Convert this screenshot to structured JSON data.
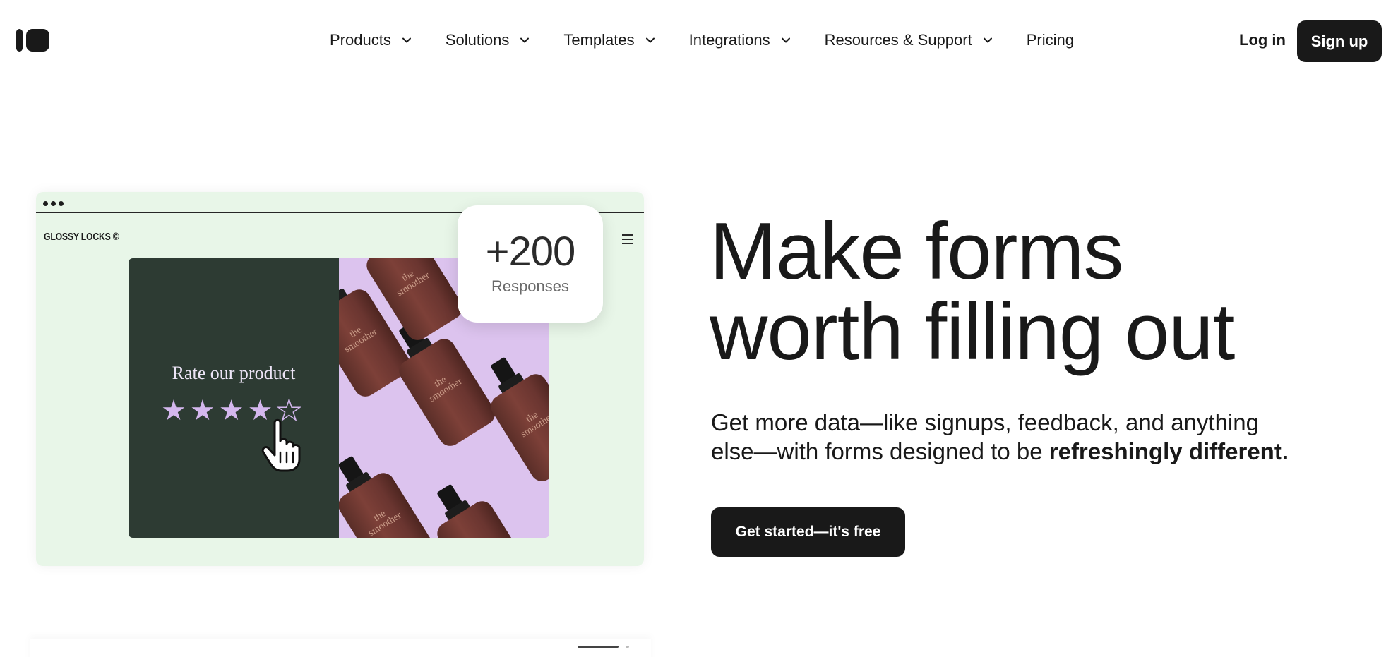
{
  "header": {
    "nav": [
      {
        "label": "Products",
        "has_dropdown": true
      },
      {
        "label": "Solutions",
        "has_dropdown": true
      },
      {
        "label": "Templates",
        "has_dropdown": true
      },
      {
        "label": "Integrations",
        "has_dropdown": true
      },
      {
        "label": "Resources & Support",
        "has_dropdown": true
      },
      {
        "label": "Pricing",
        "has_dropdown": false
      }
    ],
    "login_label": "Log in",
    "signup_label": "Sign up"
  },
  "preview": {
    "brand": "GLOSSY LOCKS ©",
    "rate_title": "Rate our product",
    "rating": {
      "filled": 4,
      "total": 5
    },
    "bottle_label": "the smoother",
    "badge_number": "+200",
    "badge_label": "Responses",
    "colors": {
      "card_bg": "#e8f6e8",
      "panel_dark": "#2d3b33",
      "panel_lilac": "#dcc3ee",
      "star": "#d4b7ee"
    }
  },
  "hero": {
    "headline_line1": "Make forms",
    "headline_line2": "worth filling out",
    "subtext_plain": "Get more data—like signups, feedback, and anything else—with forms designed to be ",
    "subtext_bold": "refreshingly different.",
    "cta_label": "Get started—it's free"
  },
  "colors": {
    "text": "#191919",
    "button_bg": "#191919",
    "button_text": "#ffffff"
  }
}
